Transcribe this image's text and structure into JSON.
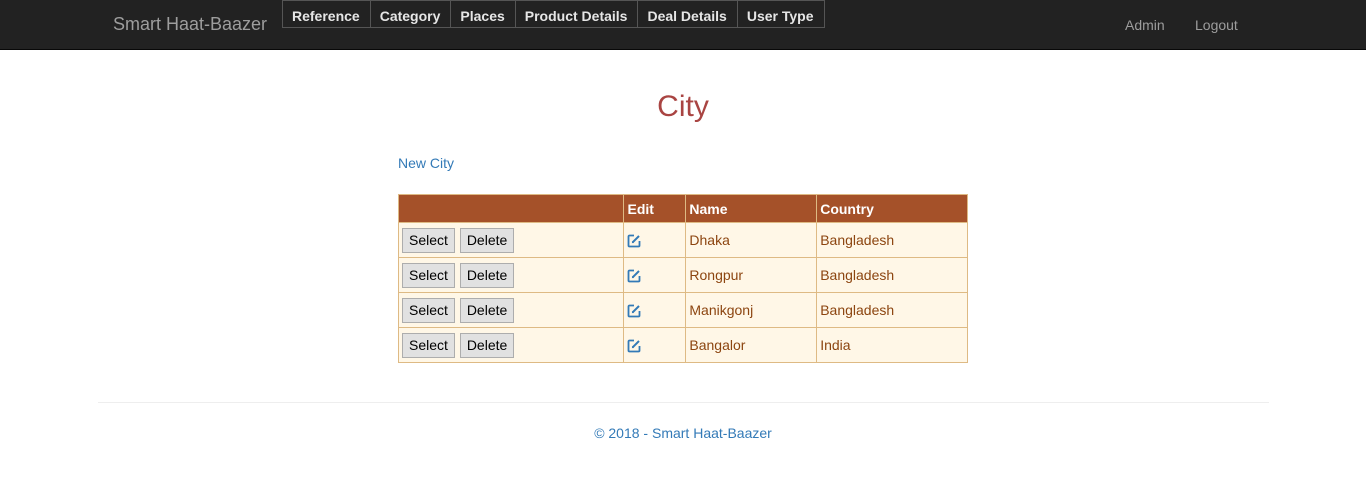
{
  "navbar": {
    "brand": "Smart Haat-Baazer",
    "menu": [
      "Reference",
      "Category",
      "Places",
      "Product Details",
      "Deal Details",
      "User Type"
    ],
    "right": {
      "admin": "Admin",
      "logout": "Logout"
    }
  },
  "page": {
    "title": "City",
    "new_link": "New City"
  },
  "table": {
    "headers": [
      "",
      "Edit",
      "Name",
      "Country"
    ],
    "select_label": "Select",
    "delete_label": "Delete",
    "rows": [
      {
        "name": "Dhaka",
        "country": "Bangladesh"
      },
      {
        "name": "Rongpur",
        "country": "Bangladesh"
      },
      {
        "name": "Manikgonj",
        "country": "Bangladesh"
      },
      {
        "name": "Bangalor",
        "country": "India"
      }
    ]
  },
  "footer": {
    "text": "© 2018 - Smart Haat-Baazer"
  },
  "colors": {
    "navbar_bg": "#222222",
    "title": "#a94442",
    "link": "#337ab7",
    "table_header_bg": "#a55129",
    "table_row_bg": "#fff7e7",
    "table_text": "#8c4510",
    "table_border": "#deba84"
  },
  "icons": {
    "edit": "edit-icon"
  }
}
